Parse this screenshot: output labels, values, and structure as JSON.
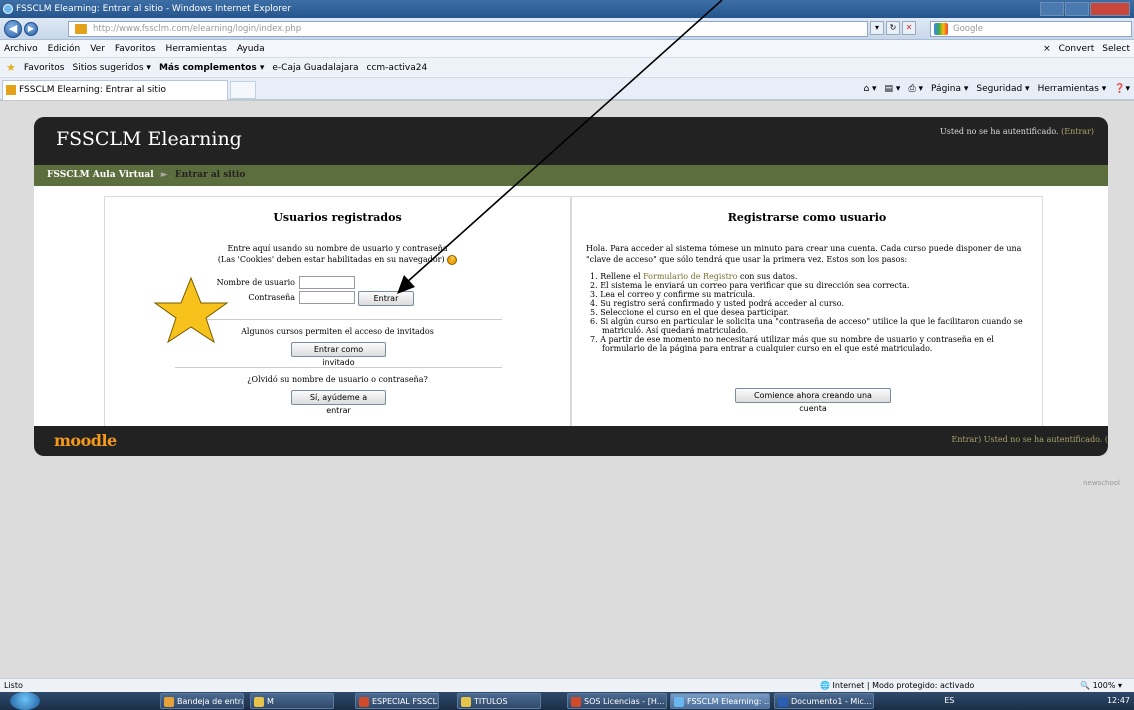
{
  "window": {
    "title": "FSSCLM Elearning: Entrar al sitio - Windows Internet Explorer"
  },
  "address": {
    "url": "http://www.fssclm.com/elearning/login/index.php",
    "search_placeholder": "Google"
  },
  "menu": [
    "Archivo",
    "Edición",
    "Ver",
    "Favoritos",
    "Herramientas",
    "Ayuda"
  ],
  "menu_right": {
    "convert": "Convert",
    "select": "Select"
  },
  "favbar": {
    "favoritos": "Favoritos",
    "items": [
      "Sitios sugeridos ▾",
      "Más complementos ▾",
      "e-Caja Guadalajara",
      "ccm-activa24"
    ]
  },
  "tab": {
    "title": "FSSCLM Elearning: Entrar al sitio"
  },
  "command_bar": [
    "Página ▾",
    "Seguridad ▾",
    "Herramientas ▾"
  ],
  "site": {
    "name": "FSSCLM Elearning",
    "login_info": "Usted no se ha autentificado.",
    "login_link": "(Entrar)",
    "breadcrumb_home": "FSSCLM Aula Virtual",
    "breadcrumb_sep": "►",
    "breadcrumb_current": "Entrar al sitio"
  },
  "login": {
    "heading": "Usuarios registrados",
    "intro_line1": "Entre aquí usando su nombre de usuario y contraseña",
    "intro_line2": "(Las 'Cookies' deben estar habilitadas en su navegador)",
    "username_label": "Nombre de usuario",
    "password_label": "Contraseña",
    "submit": "Entrar",
    "guest_text": "Algunos cursos permiten el acceso de invitados",
    "guest_button": "Entrar como invitado",
    "forgot_text": "¿Olvidó su nombre de usuario o contraseña?",
    "forgot_button": "Sí, ayúdeme a entrar"
  },
  "signup": {
    "heading": "Registrarse como usuario",
    "intro": "Hola. Para acceder al sistema tómese un minuto para crear una cuenta. Cada curso puede disponer de una \"clave de acceso\" que sólo tendrá que usar la primera vez. Estos son los pasos:",
    "step1_pre": "Rellene el ",
    "step1_link": "Formulario de Registro",
    "step1_post": " con sus datos.",
    "steps": [
      "El sistema le enviará un correo para verificar que su dirección sea correcta.",
      "Lea el correo y confirme su matrícula.",
      "Su registro será confirmado y usted podrá acceder al curso.",
      "Seleccione el curso en el que desea participar.",
      "Si algún curso en particular le solicita una \"contraseña de acceso\" utilice la que le facilitaron cuando se matriculó. Así quedará matriculado.",
      "A partir de ese momento no necesitará utilizar más que su nombre de usuario y contraseña en el formulario de la página para entrar a cualquier curso en el que esté matriculado."
    ],
    "button": "Comience ahora creando una cuenta"
  },
  "footer": {
    "logo": "moodle",
    "text": "Entrar)    Usted no se ha autentificado. (",
    "credit": "newschool"
  },
  "status": {
    "left": "Listo",
    "zone": "Internet | Modo protegido: activado",
    "zoom": "100%"
  },
  "taskbar": {
    "items": [
      "Bandeja de entrada...",
      "M",
      "ESPECIAL FSSCLM",
      "TITULOS",
      "SOS Licencias - [H...",
      "FSSCLM Elearning: ...",
      "Documento1 - Mic..."
    ],
    "lang": "ES",
    "clock": "12:47"
  },
  "annotation": {
    "shape": "star",
    "color": "#f7c21b",
    "arrow_color": "#000000"
  }
}
